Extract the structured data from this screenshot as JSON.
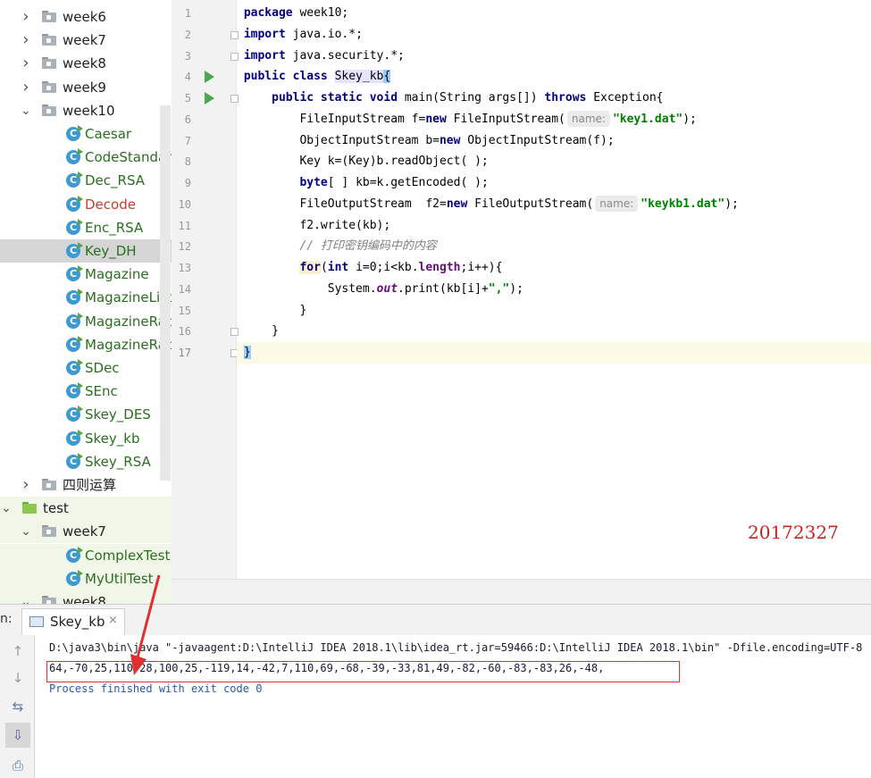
{
  "tree": {
    "items": [
      {
        "label": "week6",
        "type": "folder",
        "expanded": false,
        "depth": 1
      },
      {
        "label": "week7",
        "type": "folder",
        "expanded": false,
        "depth": 1
      },
      {
        "label": "week8",
        "type": "folder",
        "expanded": false,
        "depth": 1
      },
      {
        "label": "week9",
        "type": "folder",
        "expanded": false,
        "depth": 1
      },
      {
        "label": "week10",
        "type": "folder",
        "expanded": true,
        "depth": 1
      },
      {
        "label": "Caesar",
        "type": "class",
        "depth": 2
      },
      {
        "label": "CodeStandard",
        "type": "class",
        "depth": 2
      },
      {
        "label": "Dec_RSA",
        "type": "class",
        "depth": 2
      },
      {
        "label": "Decode",
        "type": "class",
        "depth": 2,
        "error": true
      },
      {
        "label": "Enc_RSA",
        "type": "class",
        "depth": 2
      },
      {
        "label": "Key_DH",
        "type": "class",
        "depth": 2,
        "selected": true
      },
      {
        "label": "Magazine",
        "type": "class",
        "depth": 2
      },
      {
        "label": "MagazineList",
        "type": "class",
        "depth": 2
      },
      {
        "label": "MagazineRac",
        "type": "class",
        "depth": 2
      },
      {
        "label": "MagazineRac",
        "type": "class",
        "depth": 2
      },
      {
        "label": "SDec",
        "type": "class",
        "depth": 2
      },
      {
        "label": "SEnc",
        "type": "class",
        "depth": 2
      },
      {
        "label": "Skey_DES",
        "type": "class",
        "depth": 2
      },
      {
        "label": "Skey_kb",
        "type": "class",
        "depth": 2
      },
      {
        "label": "Skey_RSA",
        "type": "class",
        "depth": 2
      },
      {
        "label": "四则运算",
        "type": "folder",
        "expanded": false,
        "depth": 1
      },
      {
        "label": "test",
        "type": "test-folder",
        "expanded": true,
        "depth": 0
      },
      {
        "label": "week7",
        "type": "folder",
        "expanded": true,
        "depth": 1
      },
      {
        "label": "ComplexTest",
        "type": "class",
        "depth": 2
      },
      {
        "label": "MyUtilTest",
        "type": "class",
        "depth": 2
      },
      {
        "label": "week8",
        "type": "folder",
        "expanded": true,
        "depth": 1
      }
    ]
  },
  "editor": {
    "line_numbers": [
      "1",
      "2",
      "3",
      "4",
      "5",
      "6",
      "7",
      "8",
      "9",
      "10",
      "11",
      "12",
      "13",
      "14",
      "15",
      "16",
      "17"
    ],
    "lines": [
      [
        {
          "t": "package",
          "c": "kw"
        },
        {
          "t": " week10;"
        }
      ],
      [
        {
          "t": "import",
          "c": "kw"
        },
        {
          "t": " java.io.*;"
        }
      ],
      [
        {
          "t": "import",
          "c": "kw"
        },
        {
          "t": " java.security.*;"
        }
      ],
      [
        {
          "t": "public class",
          "c": "kw"
        },
        {
          "t": " "
        },
        {
          "t": "Skey_kb",
          "c": "hl"
        },
        {
          "t": "{",
          "c": "brk"
        }
      ],
      [
        {
          "t": "    "
        },
        {
          "t": "public static void",
          "c": "kw"
        },
        {
          "t": " main(String args[]) "
        },
        {
          "t": "throws",
          "c": "kw"
        },
        {
          "t": " Exception{"
        }
      ],
      [
        {
          "t": "        FileInputStream f="
        },
        {
          "t": "new",
          "c": "kw"
        },
        {
          "t": " FileInputStream("
        },
        {
          "t": "name:",
          "c": "hint"
        },
        {
          "t": "\"key1.dat\"",
          "c": "str"
        },
        {
          "t": ");"
        }
      ],
      [
        {
          "t": "        ObjectInputStream b="
        },
        {
          "t": "new",
          "c": "kw"
        },
        {
          "t": " ObjectInputStream(f);"
        }
      ],
      [
        {
          "t": "        Key k=(Key)b.readObject( );"
        }
      ],
      [
        {
          "t": "        "
        },
        {
          "t": "byte",
          "c": "kw"
        },
        {
          "t": "[ ] kb=k.getEncoded( );"
        }
      ],
      [
        {
          "t": "        FileOutputStream  f2="
        },
        {
          "t": "new",
          "c": "kw"
        },
        {
          "t": " FileOutputStream("
        },
        {
          "t": "name:",
          "c": "hint"
        },
        {
          "t": "\"keykb1.dat\"",
          "c": "str"
        },
        {
          "t": ");"
        }
      ],
      [
        {
          "t": "        f2.write(kb);"
        }
      ],
      [
        {
          "t": "        "
        },
        {
          "t": "// 打印密钥编码中的内容",
          "c": "com"
        }
      ],
      [
        {
          "t": "        "
        },
        {
          "t": "for",
          "c": "kw hlfor"
        },
        {
          "t": "("
        },
        {
          "t": "int",
          "c": "kw"
        },
        {
          "t": " i=0;i<kb."
        },
        {
          "t": "length",
          "c": "fld"
        },
        {
          "t": ";i++){"
        }
      ],
      [
        {
          "t": "            System."
        },
        {
          "t": "out",
          "c": "sfld"
        },
        {
          "t": ".print(kb[i]+"
        },
        {
          "t": "\",\"",
          "c": "str"
        },
        {
          "t": ");"
        }
      ],
      [
        {
          "t": "        }"
        }
      ],
      [
        {
          "t": "    }"
        }
      ],
      [
        {
          "t": "}",
          "c": "brk"
        }
      ]
    ],
    "watermark": "20172327"
  },
  "run": {
    "label": "n:",
    "tab_title": "Skey_kb",
    "tab_close": "×",
    "output": [
      "D:\\java3\\bin\\java \"-javaagent:D:\\IntelliJ IDEA 2018.1\\lib\\idea_rt.jar=59466:D:\\IntelliJ IDEA 2018.1\\bin\" -Dfile.encoding=UTF-8",
      "64,-70,25,110,28,100,25,-119,14,-42,7,110,69,-68,-39,-33,81,49,-82,-60,-83,-83,26,-48,",
      "Process finished with exit code 0"
    ]
  },
  "colors": {
    "annotation": "#e03030",
    "watermark": "#cc2222",
    "selected_row": "#d5d5d5",
    "current_line": "#fcfae4"
  },
  "icons": [
    "chevron-right-icon",
    "chevron-down-icon",
    "folder-icon",
    "class-icon",
    "run-icon",
    "fold-icon",
    "rerun-up-icon",
    "rerun-down-icon",
    "soft-wrap-icon",
    "scroll-to-end-icon",
    "print-icon"
  ]
}
